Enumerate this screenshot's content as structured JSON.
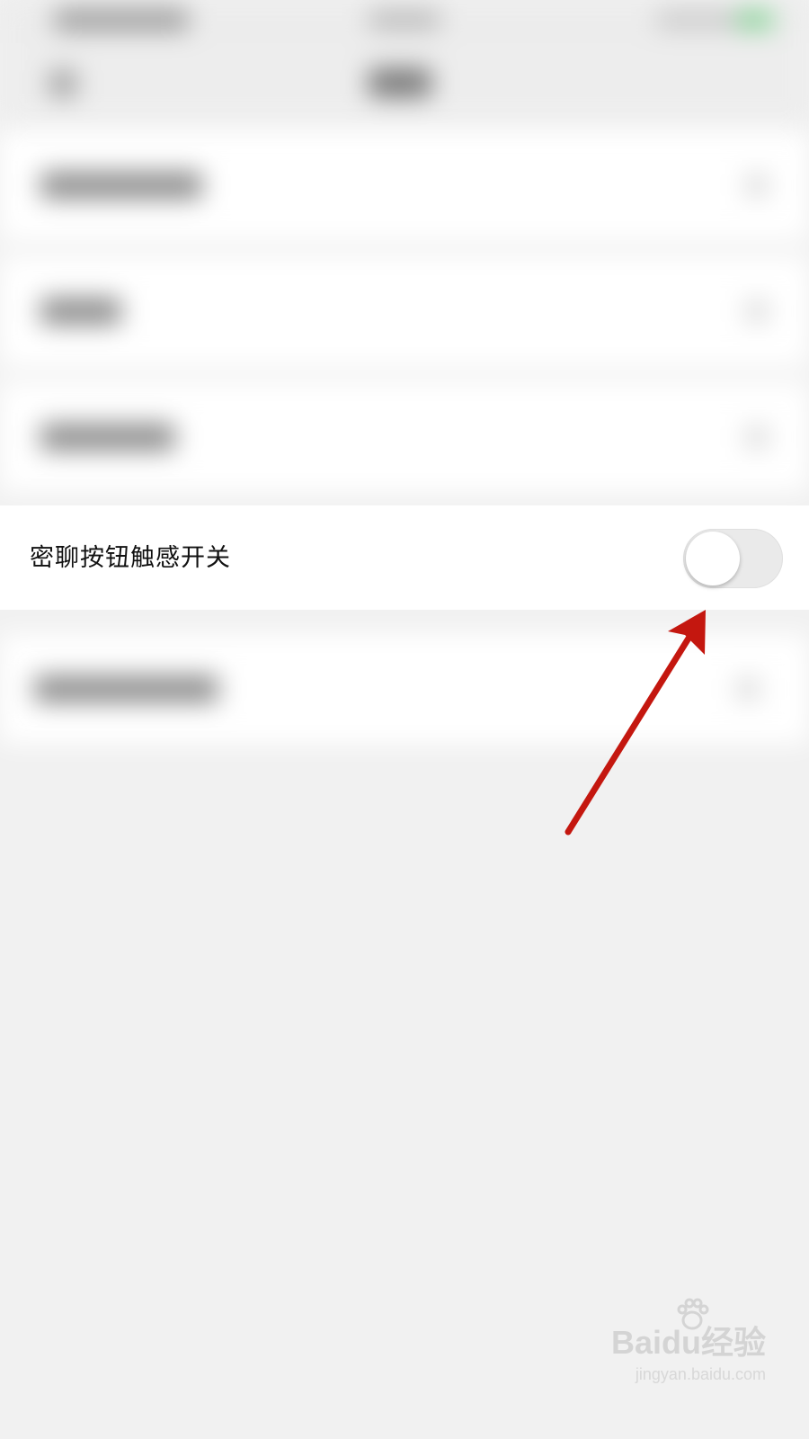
{
  "setting_row": {
    "label": "密聊按钮触感开关",
    "toggle_on": false
  },
  "colors": {
    "background": "#f1f1f1",
    "row_background": "#ffffff",
    "toggle_track_off": "#eaeaea",
    "toggle_knob": "#ffffff",
    "annotation_arrow": "#c4170f"
  },
  "annotation": {
    "icon": "red-arrow-icon"
  },
  "watermark": {
    "logo": "Baidu经验",
    "url": "jingyan.baidu.com"
  }
}
